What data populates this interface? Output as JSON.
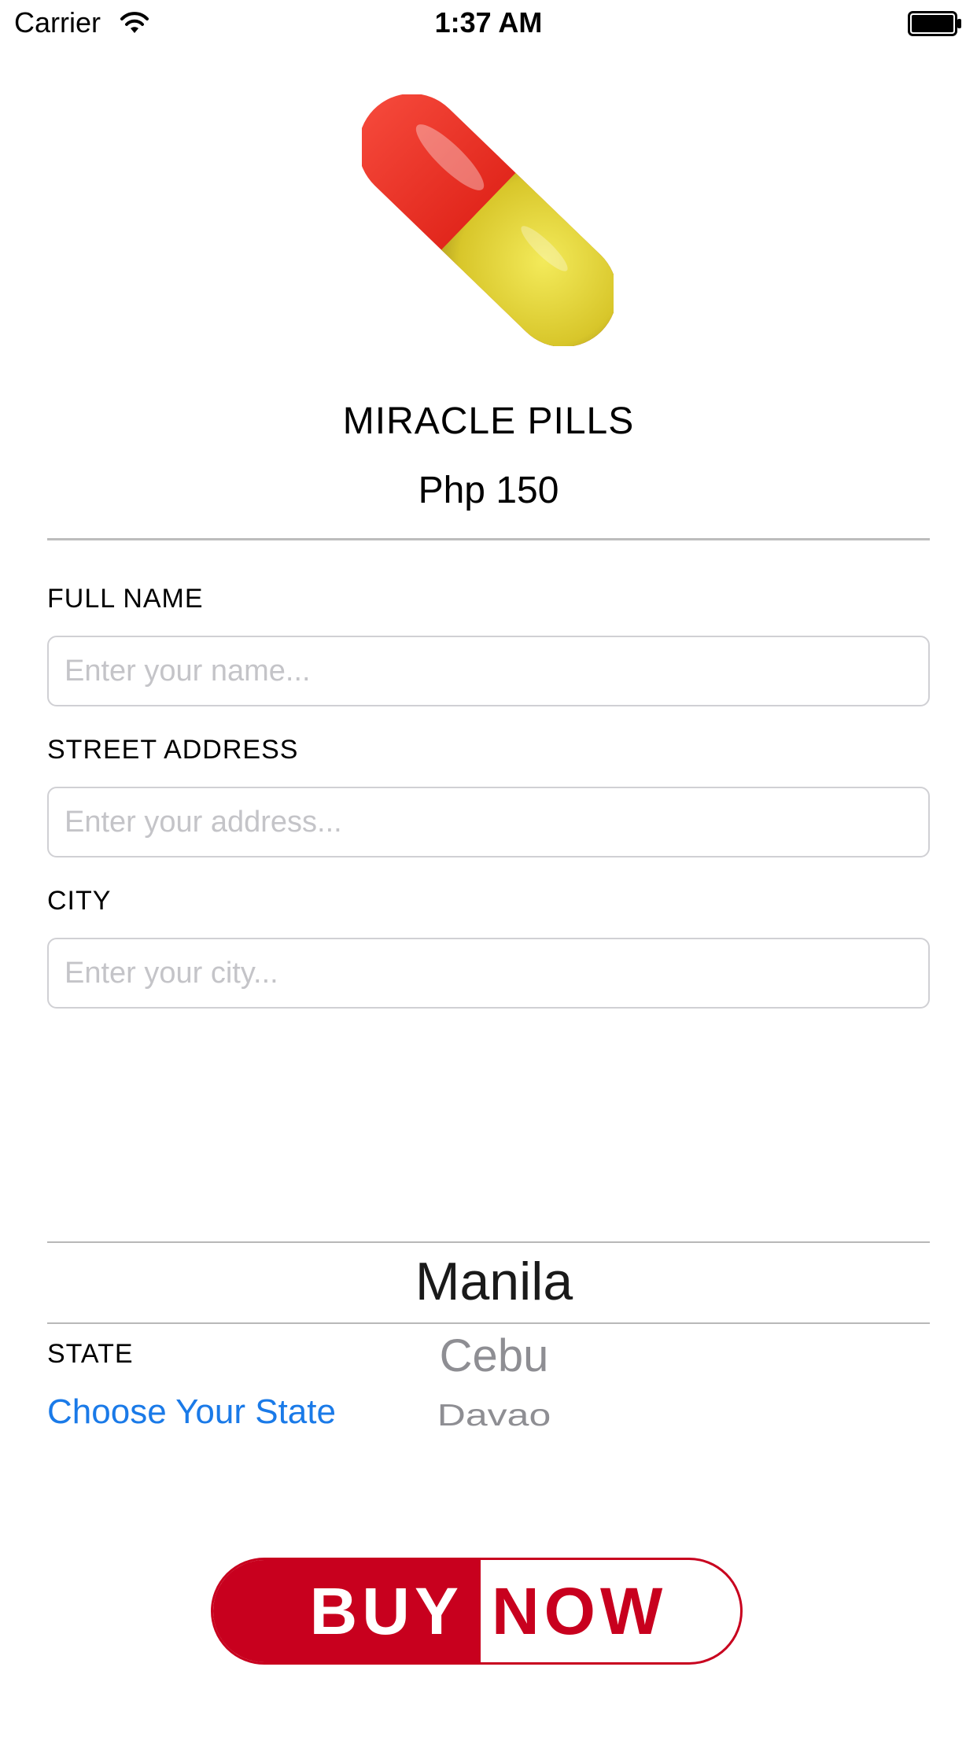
{
  "status_bar": {
    "carrier": "Carrier",
    "time": "1:37 AM",
    "wifi_icon": "wifi-icon",
    "battery_icon": "battery-icon"
  },
  "product": {
    "image_icon": "pill-icon",
    "name": "MIRACLE PILLS",
    "price": "Php 150"
  },
  "form": {
    "full_name": {
      "label": "FULL NAME",
      "value": "",
      "placeholder": "Enter your name..."
    },
    "street_address": {
      "label": "STREET ADDRESS",
      "value": "",
      "placeholder": "Enter your address..."
    },
    "city": {
      "label": "CITY",
      "value": "",
      "placeholder": "Enter your city..."
    },
    "state": {
      "label": "STATE",
      "choose_link": "Choose Your State",
      "picker_options": [
        "Manila",
        "Cebu",
        "Davao"
      ],
      "selected": "Manila"
    }
  },
  "buy_button": {
    "left_text": "BUY",
    "right_text": "NOW"
  },
  "colors": {
    "accent_red": "#c8001e",
    "link_blue": "#1a7ae8",
    "pill_red": "#e0241a",
    "pill_yellow": "#e3d62e"
  }
}
